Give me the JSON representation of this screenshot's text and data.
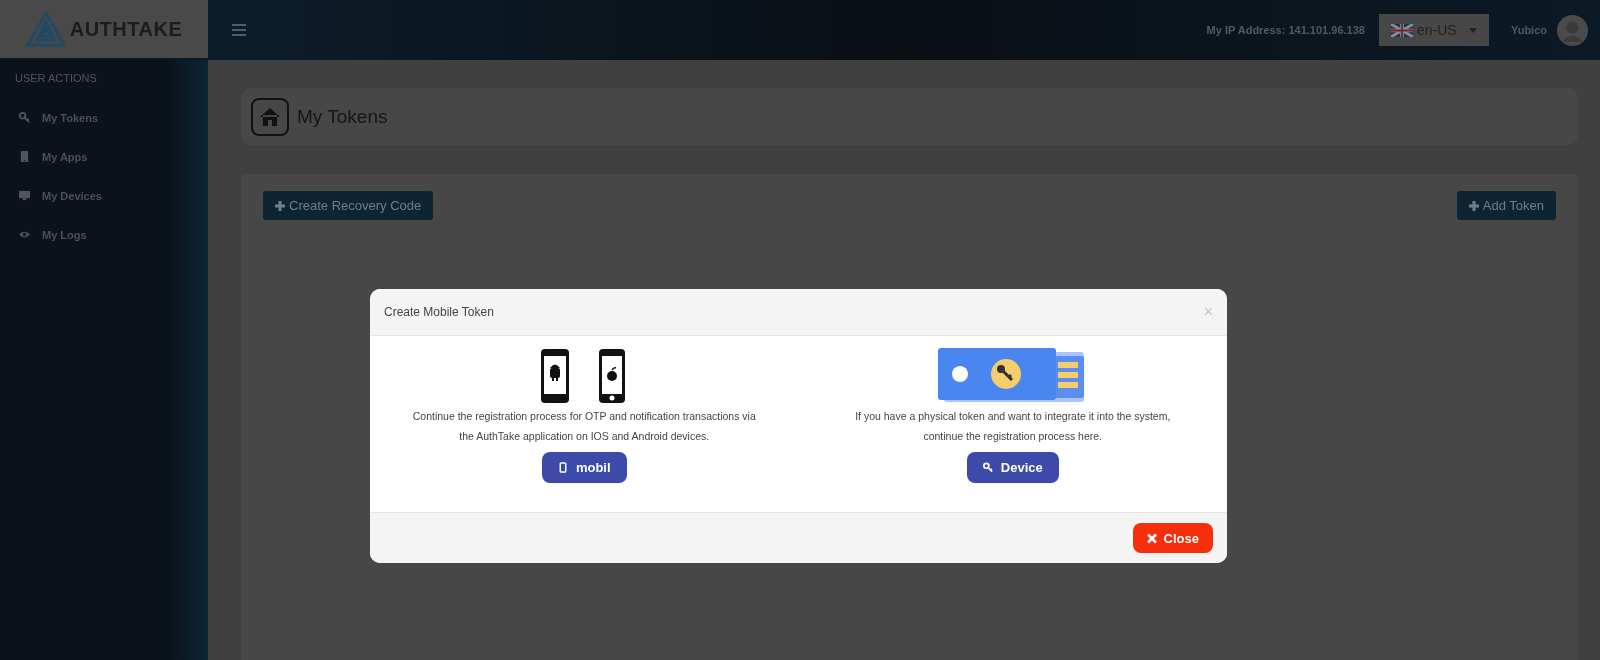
{
  "brand": {
    "name": "AUTHTAKE"
  },
  "topbar": {
    "ip_label": "My IP Address: 141.101.96.138",
    "language": "en-US",
    "user": "Yubico"
  },
  "sidebar": {
    "heading": "USER ACTIONS",
    "items": [
      {
        "label": "My Tokens",
        "kind": "key"
      },
      {
        "label": "My Apps",
        "kind": "tablet"
      },
      {
        "label": "My Devices",
        "kind": "monitor"
      },
      {
        "label": "My Logs",
        "kind": "eye"
      }
    ]
  },
  "page": {
    "title": "My Tokens",
    "left_button": "Create Recovery Code",
    "right_button": "Add Token"
  },
  "modal": {
    "title": "Create Mobile Token",
    "close_glyph": "×",
    "options": [
      {
        "kind": "mobile",
        "lines": [
          "Continue the registration process for OTP and notification transactions via",
          "the AuthTake application on IOS and Android devices."
        ],
        "button": "mobil"
      },
      {
        "kind": "device",
        "lines": [
          "If you have a physical token and want to integrate it into the system,",
          "continue the registration process here."
        ],
        "button": "Device"
      }
    ],
    "footer_button": "Close"
  }
}
